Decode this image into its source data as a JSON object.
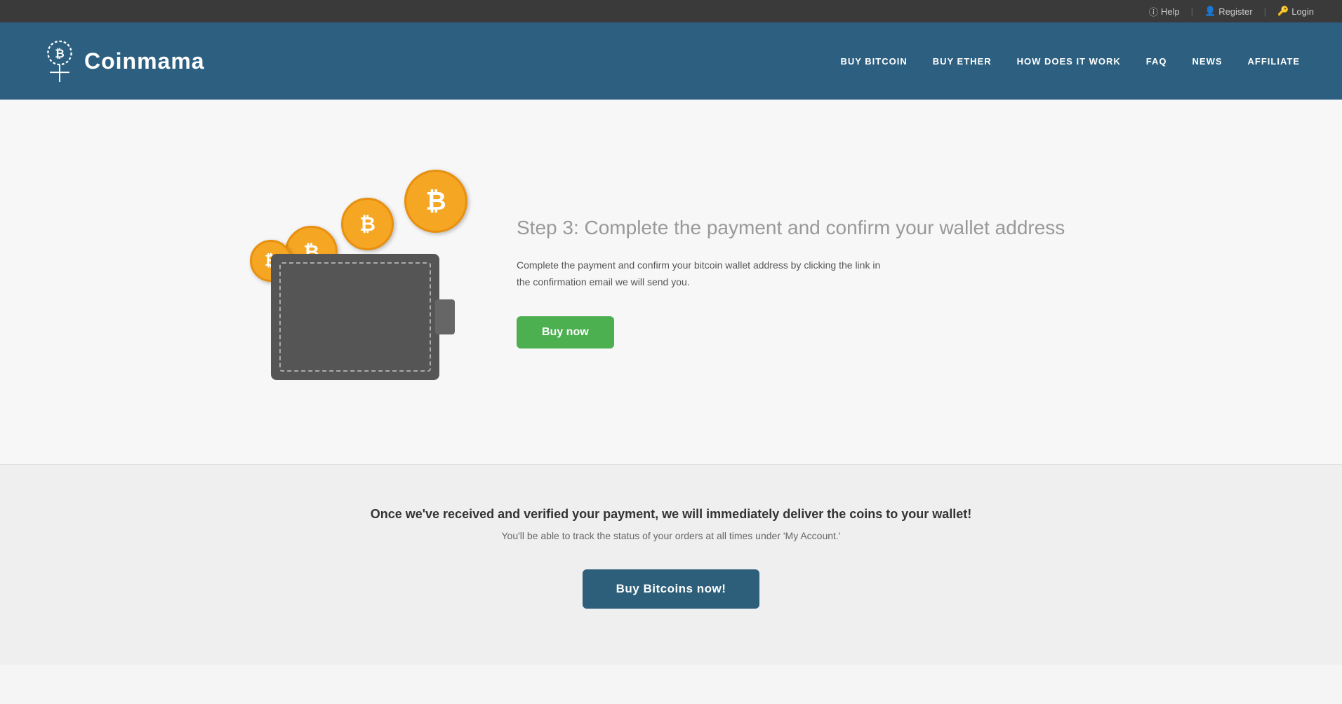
{
  "topbar": {
    "help_label": "Help",
    "register_label": "Register",
    "login_label": "Login"
  },
  "header": {
    "logo_text_bold": "Coin",
    "logo_text_light": "mama",
    "nav": {
      "buy_bitcoin": "BUY BITCOIN",
      "buy_ether": "BUY ETHER",
      "how_it_works": "HOW DOES IT WORK",
      "faq": "FAQ",
      "news": "NEWS",
      "affiliate": "AFFILIATE"
    }
  },
  "step": {
    "title": "Step 3: Complete the payment and confirm your wallet address",
    "description": "Complete the payment and confirm your bitcoin wallet address by clicking the link in the confirmation email we will send you.",
    "buy_now_label": "Buy now"
  },
  "bottom": {
    "main_text": "Once we've received and verified your payment, we will immediately deliver the coins to your wallet!",
    "sub_text": "You'll be able to track the status of your orders at all times under 'My Account.'",
    "cta_label": "Buy Bitcoins now!"
  }
}
